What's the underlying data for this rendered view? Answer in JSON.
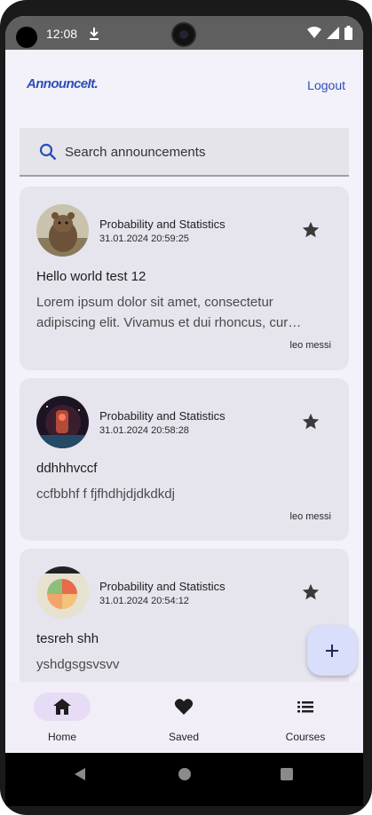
{
  "status_bar": {
    "time": "12:08",
    "icons": [
      "download-icon",
      "wifi-icon",
      "signal-icon",
      "battery-icon"
    ]
  },
  "app_bar": {
    "logo": "AnnounceIt.",
    "logout_label": "Logout"
  },
  "search": {
    "placeholder": "Search announcements"
  },
  "announcements": [
    {
      "course": "Probability and Statistics",
      "date": "31.01.2024 20:59:25",
      "title": "Hello world test 12",
      "body": "Lorem ipsum dolor sit amet, consectetur adipiscing elit. Vivamus et dui rhoncus, cur…",
      "author": "leo messi",
      "avatar": "quokka-photo"
    },
    {
      "course": "Probability and Statistics",
      "date": "31.01.2024 20:58:28",
      "title": "ddhhhvccf",
      "body": "ccfbbhf f fjfhdhjdjdkdkdj",
      "author": "leo messi",
      "avatar": "space-art"
    },
    {
      "course": "Probability and Statistics",
      "date": "31.01.2024 20:54:12",
      "title": "tesreh shh",
      "body": "yshdgsgsvsvv",
      "author": "",
      "avatar": "pie-chart-image"
    }
  ],
  "fab": {
    "icon": "plus-icon"
  },
  "bottom_nav": [
    {
      "label": "Home",
      "icon": "home-icon",
      "active": true
    },
    {
      "label": "Saved",
      "icon": "heart-icon",
      "active": false
    },
    {
      "label": "Courses",
      "icon": "list-icon",
      "active": false
    }
  ],
  "colors": {
    "accent": "#2b4fb8",
    "card_bg": "#e6e4ed",
    "screen_bg": "#f3f1fa",
    "nav_active_pill": "#e6dcf5",
    "fab_bg": "#d9defb"
  }
}
